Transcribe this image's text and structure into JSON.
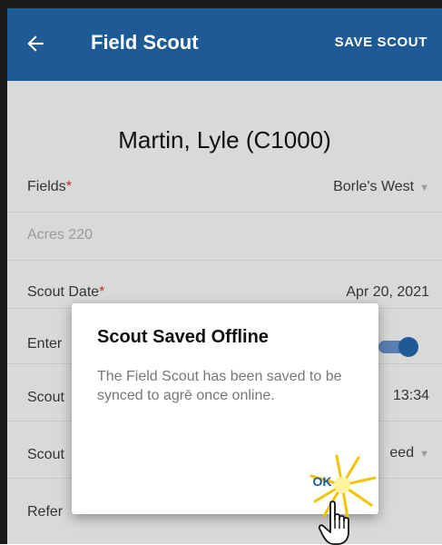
{
  "appbar": {
    "back_icon": "arrow-left-icon",
    "title": "Field Scout",
    "action_label": "SAVE SCOUT",
    "color": "#1e5a96"
  },
  "customer_name": "Martin, Lyle (C1000)",
  "form": {
    "fields": {
      "label": "Fields",
      "required_mark": "*",
      "value": "Borle's West"
    },
    "acres": {
      "label": "Acres",
      "value": "220"
    },
    "scout_date": {
      "label": "Scout Date",
      "required_mark": "*",
      "value": "Apr 20, 2021"
    },
    "enter_row": {
      "label": "Enter"
    },
    "scout_time": {
      "label": "Scout",
      "value": "13:34"
    },
    "scout_type": {
      "label": "Scout",
      "value": "eed"
    },
    "reference": {
      "label": "Refer"
    }
  },
  "dialog": {
    "title": "Scout Saved Offline",
    "message": "The Field Scout has been saved to be synced to agrē once online.",
    "ok_label": "OK",
    "accent_color": "#1e5a96"
  },
  "cursor": {
    "icon": "hand-pointer-icon"
  }
}
